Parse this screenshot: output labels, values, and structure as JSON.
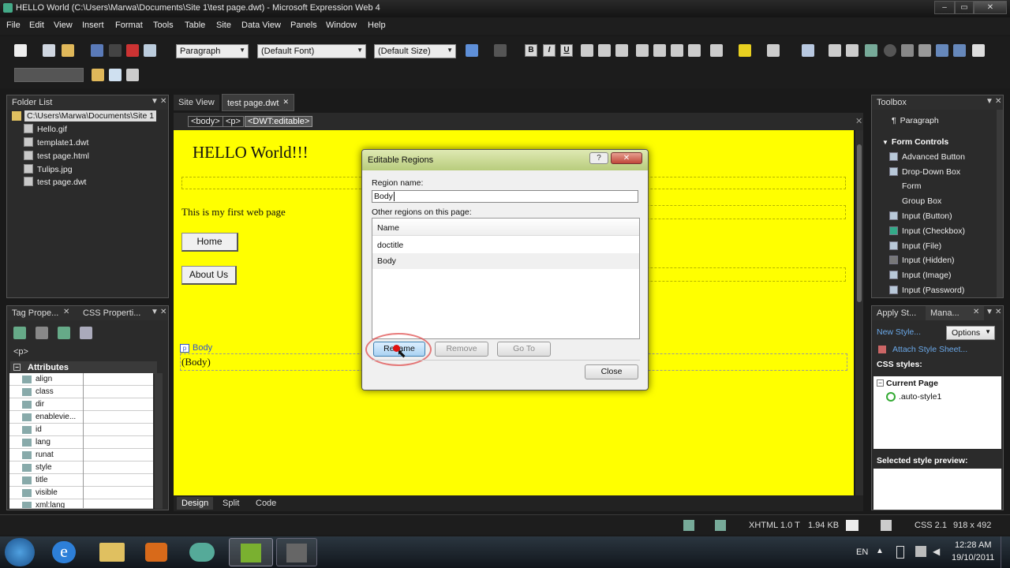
{
  "window": {
    "title": "HELLO World (C:\\Users\\Marwa\\Documents\\Site 1\\test page.dwt) - Microsoft Expression Web 4"
  },
  "menu": [
    "File",
    "Edit",
    "View",
    "Insert",
    "Format",
    "Tools",
    "Table",
    "Site",
    "Data View",
    "Panels",
    "Window",
    "Help"
  ],
  "toolbar": {
    "style_combo": "Paragraph",
    "font_combo": "(Default Font)",
    "size_combo": "(Default Size)",
    "bold": "B",
    "italic": "I",
    "underline": "U"
  },
  "folder_list": {
    "title": "Folder List",
    "root": "C:\\Users\\Marwa\\Documents\\Site 1",
    "items": [
      "Hello.gif",
      "template1.dwt",
      "test page.html",
      "Tulips.jpg",
      "test page.dwt"
    ]
  },
  "tag_properties": {
    "tab1": "Tag Prope...",
    "tab2": "CSS Properti...",
    "tag": "<p>",
    "section": "Attributes",
    "attributes": [
      "align",
      "class",
      "dir",
      "enablevie...",
      "id",
      "lang",
      "runat",
      "style",
      "title",
      "visible",
      "xml:lang"
    ]
  },
  "editor": {
    "tabs": [
      "Site View",
      "test page.dwt"
    ],
    "breadcrumb": [
      "<body>",
      "<p>",
      "<DWT:editable>"
    ],
    "heading": "HELLO World!!!",
    "paragraph": "This is my first web page",
    "btn_home": "Home",
    "btn_about": "About Us",
    "region_label": "Body",
    "region_content": "(Body)",
    "view_tabs": [
      "Design",
      "Split",
      "Code"
    ]
  },
  "dialog": {
    "title": "Editable Regions",
    "help": "?",
    "region_name_label": "Region name:",
    "region_name_value": "Body",
    "other_regions_label": "Other regions on this page:",
    "column": "Name",
    "regions": [
      "doctitle",
      "Body"
    ],
    "btn_rename": "Rename",
    "btn_remove": "Remove",
    "btn_goto": "Go To",
    "btn_close": "Close"
  },
  "toolbox": {
    "title": "Toolbox",
    "paragraph_item": "Paragraph",
    "group": "Form Controls",
    "items": [
      "Advanced Button",
      "Drop-Down Box",
      "Form",
      "Group Box",
      "Input (Button)",
      "Input (Checkbox)",
      "Input (File)",
      "Input (Hidden)",
      "Input (Image)",
      "Input (Password)"
    ]
  },
  "styles_panel": {
    "tab1": "Apply St...",
    "tab2": "Mana...",
    "new_style": "New Style...",
    "options": "Options",
    "attach": "Attach Style Sheet...",
    "css_styles": "CSS styles:",
    "current_page": "Current Page",
    "style_item": ".auto-style1",
    "preview": "Selected style preview:"
  },
  "status": {
    "doctype": "XHTML 1.0 T",
    "size": "1.94 KB",
    "css": "CSS 2.1",
    "dims": "918 x 492"
  },
  "taskbar": {
    "lang": "EN",
    "time": "12:28 AM",
    "date": "19/10/2011"
  },
  "colors": {
    "design_bg": "#ffff00",
    "dialog_caption": "#c8d890"
  }
}
